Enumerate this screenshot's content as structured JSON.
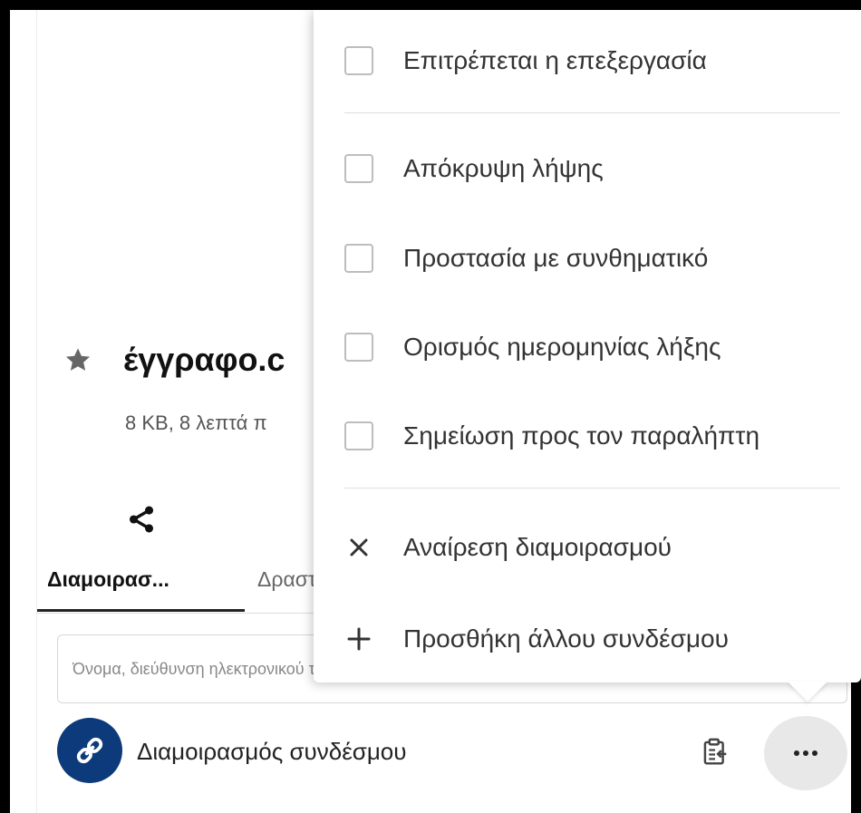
{
  "file": {
    "name": "έγγραφο.c",
    "meta": "8 KB, 8 λεπτά π"
  },
  "tabs": [
    {
      "label": "Διαμοιρασ...",
      "active": true
    },
    {
      "label": "Δραστ",
      "active": false
    }
  ],
  "share_input": {
    "placeholder": "Όνομα, διεύθυνση ηλεκτρονικού ταχυδρομείου ή ομοσπονδιακό Cloud ID..."
  },
  "link_share": {
    "label": "Διαμοιρασμός συνδέσμου",
    "avatar_color": "#0d3a7a"
  },
  "menu": {
    "items": [
      {
        "type": "checkbox",
        "label": "Επιτρέπεται η επεξεργασία",
        "checked": false
      },
      {
        "type": "checkbox",
        "label": "Απόκρυψη λήψης",
        "checked": false
      },
      {
        "type": "checkbox",
        "label": "Προστασία με συνθηματικό",
        "checked": false
      },
      {
        "type": "checkbox",
        "label": "Ορισμός ημερομηνίας λήξης",
        "checked": false
      },
      {
        "type": "checkbox",
        "label": "Σημείωση προς τον παραλήπτη",
        "checked": false
      },
      {
        "type": "action",
        "icon": "close-icon",
        "label": "Αναίρεση διαμοιρασμού"
      },
      {
        "type": "action",
        "icon": "plus-icon",
        "label": "Προσθήκη άλλου συνδέσμου"
      }
    ]
  },
  "colors": {
    "accent": "#0d3a7a",
    "text": "#333333",
    "muted": "#555555"
  }
}
